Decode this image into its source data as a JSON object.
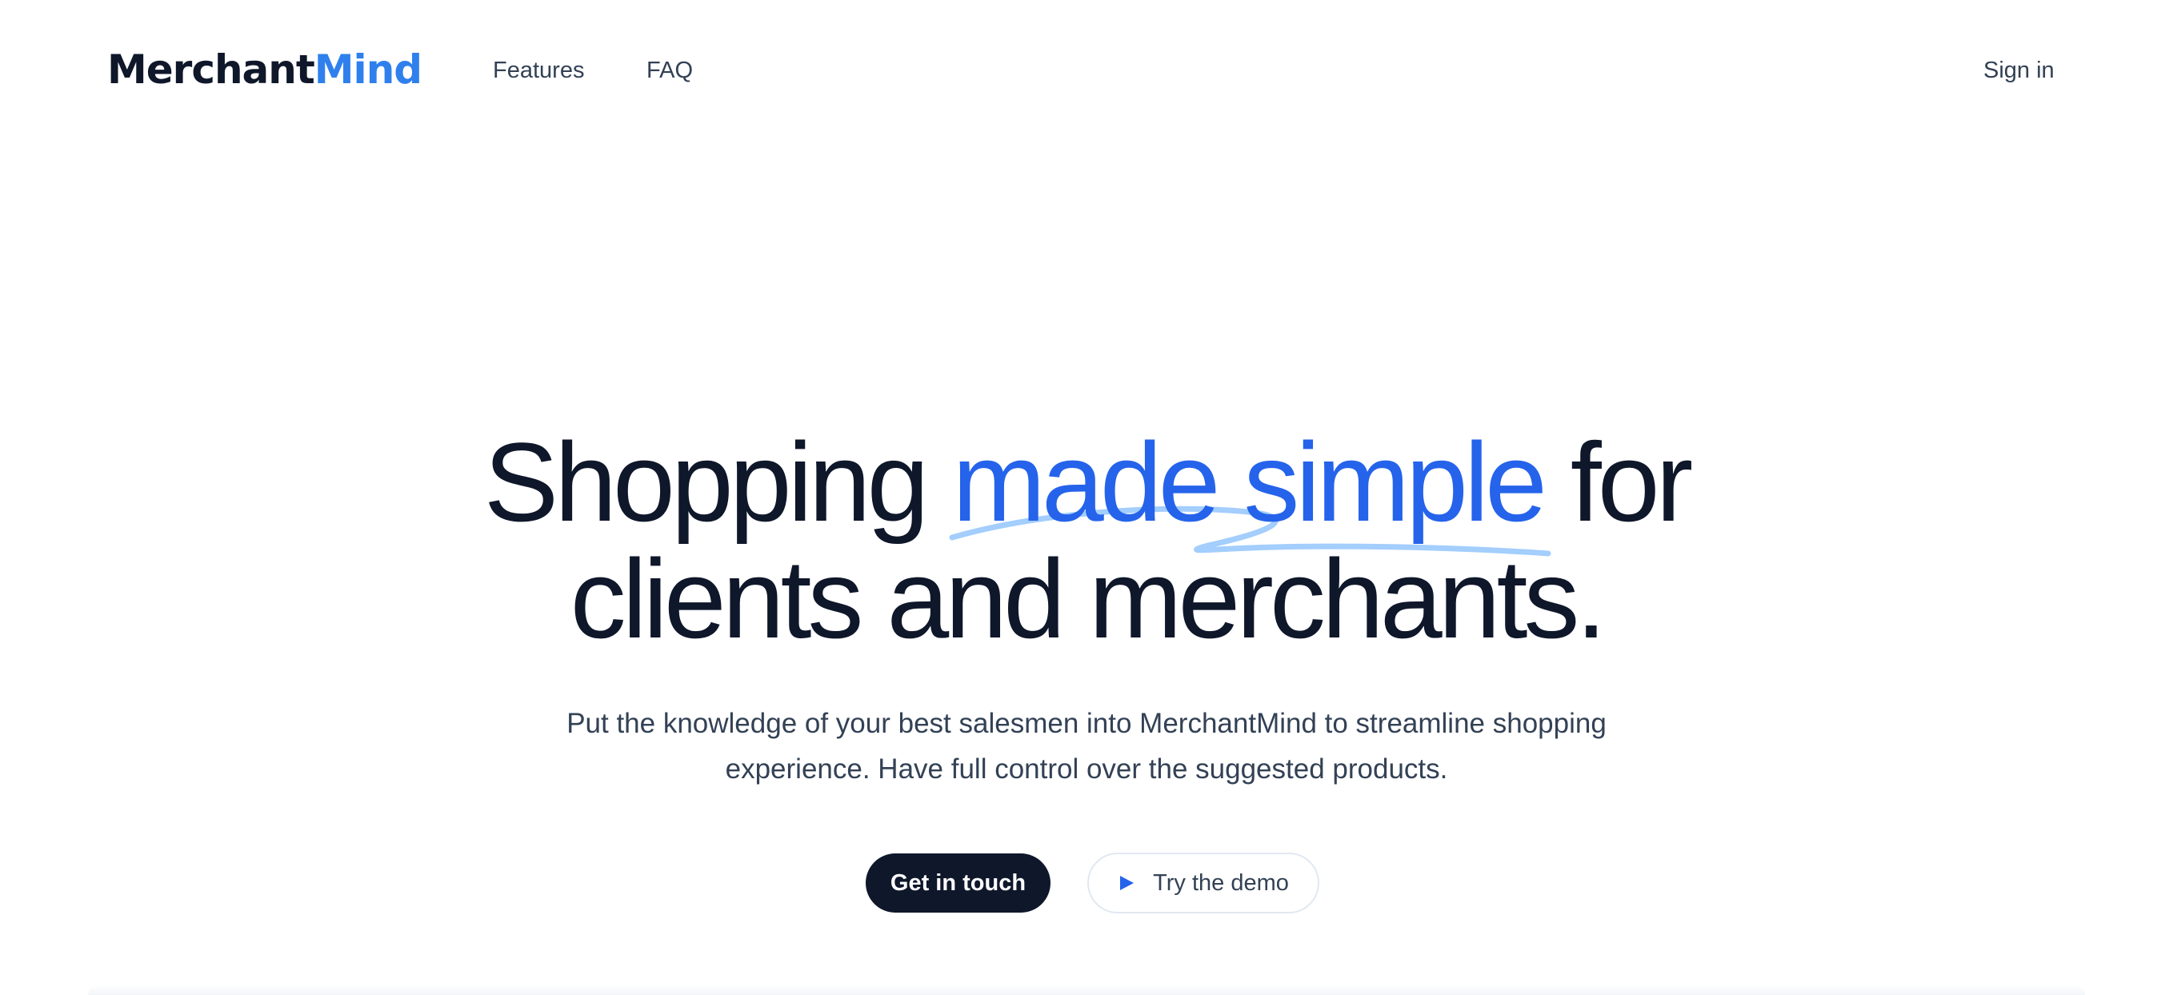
{
  "header": {
    "logo_part1": "Merchant",
    "logo_part2": "Mind",
    "nav": [
      {
        "label": "Features"
      },
      {
        "label": "FAQ"
      }
    ],
    "sign_in_label": "Sign in"
  },
  "hero": {
    "title_start": "Shopping ",
    "title_accent": "made simple",
    "title_mid": " for",
    "title_line2": "clients and merchants.",
    "subtitle_line1": "Put the knowledge of your best salesmen into MerchantMind to streamline shopping",
    "subtitle_line2": "experience. Have full control over the suggested products.",
    "primary_button": "Get in touch",
    "secondary_button": "Try the demo"
  },
  "colors": {
    "brand_dark": "#0f172a",
    "brand_blue": "#2563eb",
    "logo_blue": "#2f80ed",
    "scribble": "#93c5fd"
  },
  "icons": {
    "demo_button_icon": "play-icon"
  }
}
